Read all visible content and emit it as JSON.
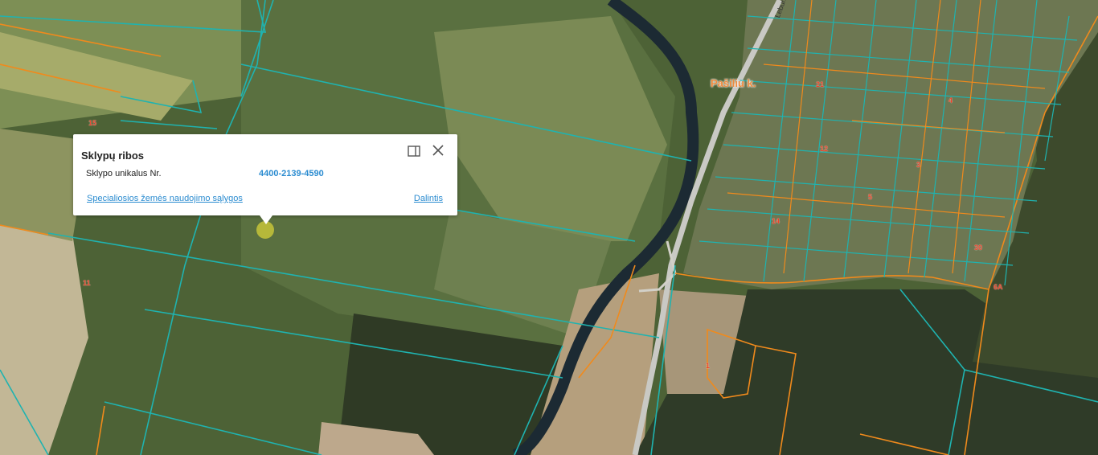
{
  "popup": {
    "title": "Sklypų ribos",
    "label": "Sklypo unikalus Nr.",
    "value": "4400-2139-4590",
    "link_conditions": "Specialiosios žemės naudojimo sąlygos",
    "link_share": "Dalintis",
    "expand_icon": "expand-icon",
    "close_icon": "close-icon"
  },
  "map": {
    "place_label": "Pašiliu k.",
    "street_label": "Lebuno g.",
    "parcel_numbers": [
      "15",
      "11",
      "1",
      "6A",
      "30",
      "3",
      "12",
      "21",
      "14",
      "5",
      "4"
    ]
  },
  "colors": {
    "parcel_teal": "#1fb3b0",
    "parcel_orange": "#f08a1c",
    "link_blue": "#2a8bd0",
    "marker": "#c7c43a"
  }
}
